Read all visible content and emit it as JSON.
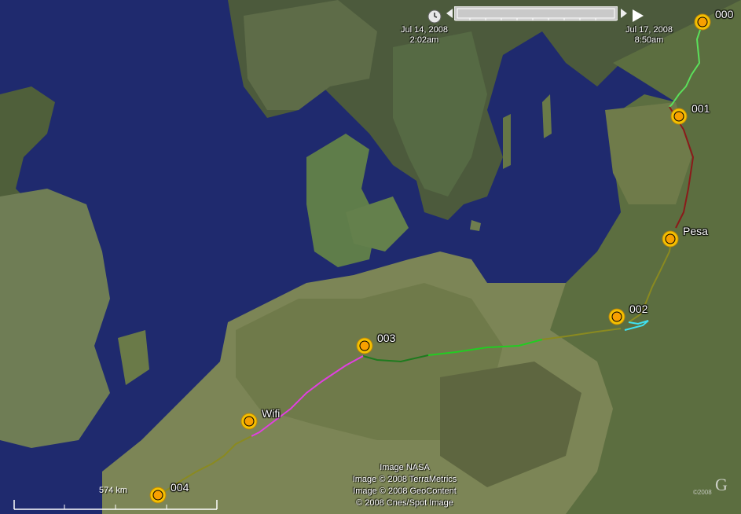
{
  "timeline": {
    "start_date": "Jul 14, 2008",
    "start_time": "2:02am",
    "end_date": "Jul 17, 2008",
    "end_time": "8:50am"
  },
  "placemarks": [
    {
      "name": "000"
    },
    {
      "name": "001"
    },
    {
      "name": "Pesa"
    },
    {
      "name": "002"
    },
    {
      "name": "003"
    },
    {
      "name": "Wifi"
    },
    {
      "name": "004"
    }
  ],
  "credits": {
    "line1": "Image NASA",
    "line2": "Image © 2008 TerraMetrics",
    "line3": "Image © 2008 GeoContent",
    "line4": "© 2008 Cnes/Spot Image"
  },
  "scale": {
    "label": "574 km"
  },
  "brand": {
    "logo_text": "G",
    "small_text": "©2008"
  },
  "colors": {
    "sea": "#1f2a6e",
    "route_green": "#5be05b",
    "route_dark_red": "#8b1a1a",
    "route_olive": "#8a8a20",
    "route_cyan": "#40e0f0",
    "route_bright_green": "#22cc22",
    "route_dark_green": "#1f7a1f",
    "route_magenta": "#e040e0"
  },
  "icons": {
    "placemark": "sun-icon",
    "clock": "clock-icon",
    "play": "play-icon"
  }
}
